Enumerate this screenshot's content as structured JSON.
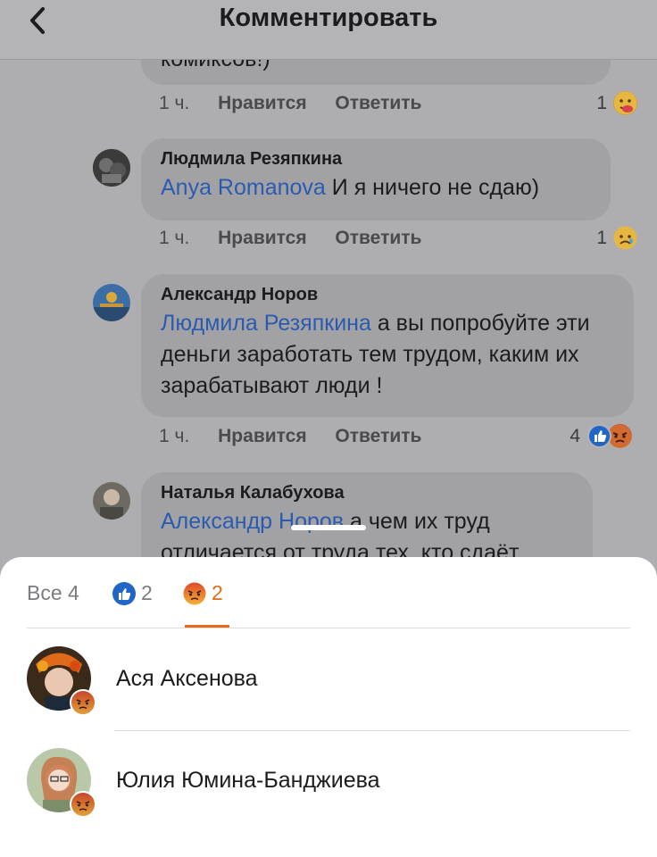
{
  "header": {
    "title": "Комментировать"
  },
  "comments": [
    {
      "author": "",
      "text": "комиксов!)",
      "meta": {
        "time": "1 ч.",
        "like": "Нравится",
        "reply": "Ответить",
        "count": "1",
        "reactions": [
          "care-face-icon"
        ]
      }
    },
    {
      "author": "Людмила Резяпкина",
      "mention": "Anya Romanova",
      "text": "И я ничего не сдаю)",
      "meta": {
        "time": "1 ч.",
        "like": "Нравится",
        "reply": "Ответить",
        "count": "1",
        "reactions": [
          "sad-face-icon"
        ]
      }
    },
    {
      "author": "Александр Норов",
      "mention": "Людмила Резяпкина",
      "text": "а вы попробуйте эти деньги заработать тем трудом, каким их зарабатывают люди !",
      "meta": {
        "time": "1 ч.",
        "like": "Нравится",
        "reply": "Ответить",
        "count": "4",
        "reactions": [
          "like-icon",
          "angry-face-icon"
        ]
      }
    },
    {
      "author": "Наталья Калабухова",
      "mention": "Александр Норов",
      "text": "а чем их труд отличается от труда тех, кто сдаёт",
      "meta": null
    }
  ],
  "reactions_sheet": {
    "tabs": [
      {
        "label": "Все 4",
        "icon": null
      },
      {
        "label": "2",
        "icon": "like-icon"
      },
      {
        "label": "2",
        "icon": "angry-face-icon",
        "active": true
      }
    ],
    "people": [
      {
        "name": "Ася Аксенова",
        "reaction": "angry-face-icon"
      },
      {
        "name": "Юлия Юмина-Банджиева",
        "reaction": "angry-face-icon"
      }
    ]
  },
  "colors": {
    "mention": "#2b5bb0",
    "active_tab": "#e26a18",
    "like_blue": "#1f66c7"
  }
}
